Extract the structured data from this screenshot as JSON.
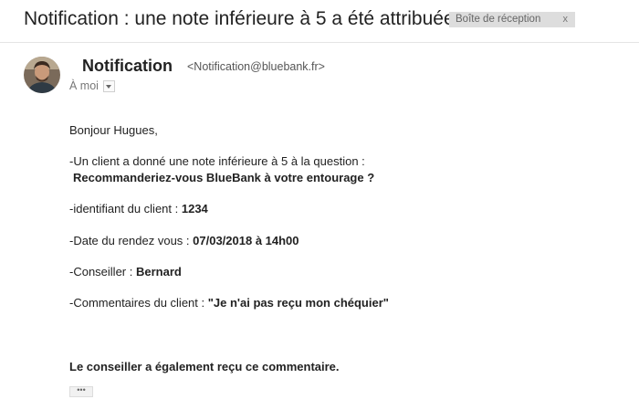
{
  "header": {
    "subject": "Notification : une note inférieure à 5 a été attribuée",
    "label": "Boîte de réception",
    "label_close": "x"
  },
  "sender": {
    "name": "Notification",
    "email": "<Notification@bluebank.fr>",
    "recipient": "À moi"
  },
  "message": {
    "greeting": "Bonjour Hugues,",
    "line1": "-Un client a donné une note inférieure à 5 à la question :",
    "question": "Recommanderiez-vous BlueBank à votre entourage ?",
    "client_id_label": "-identifiant du client : ",
    "client_id_value": "1234",
    "date_label": "-Date du rendez vous : ",
    "date_value": "07/03/2018 à 14h00",
    "advisor_label": "-Conseiller : ",
    "advisor_value": "Bernard",
    "comments_label": "-Commentaires du client : ",
    "comments_value": "\"Je n'ai pas reçu mon chéquier\"",
    "footer": "Le conseiller a également reçu ce commentaire.",
    "ellipsis": "•••"
  }
}
